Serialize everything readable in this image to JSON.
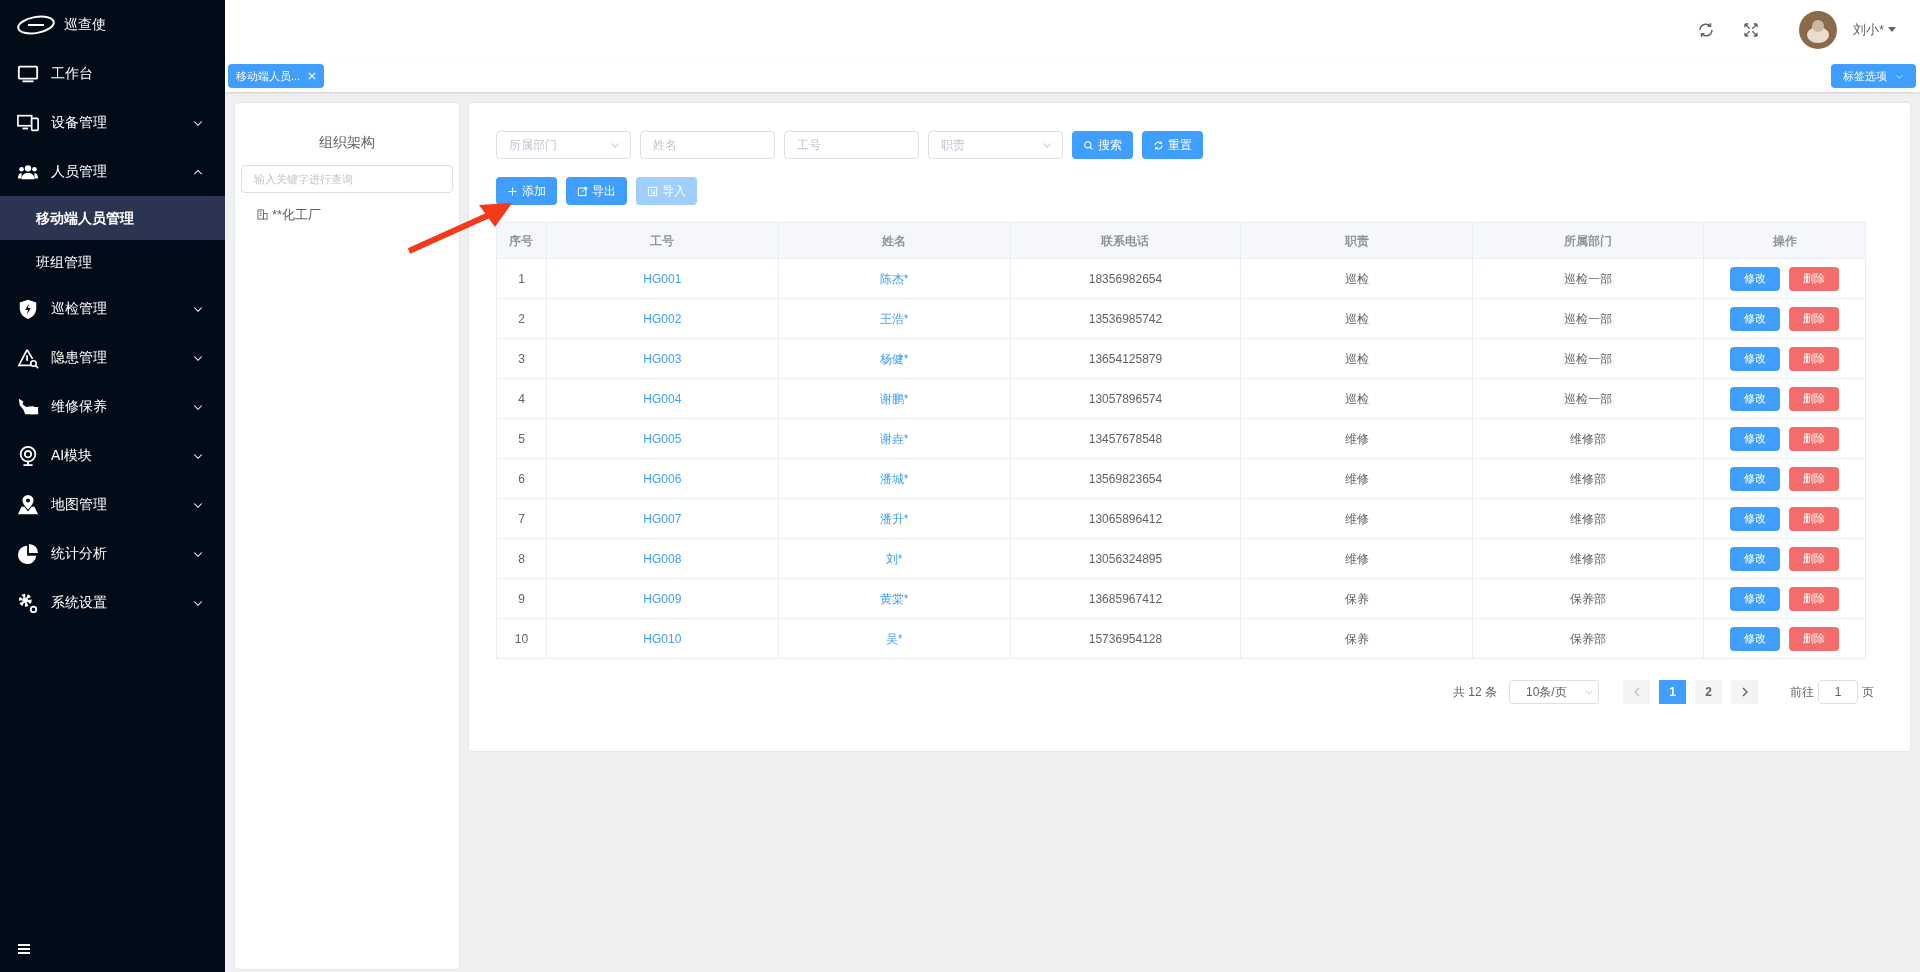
{
  "app": {
    "title": "巡查使"
  },
  "sidebar": {
    "items": [
      {
        "label": "工作台",
        "has_children": false
      },
      {
        "label": "设备管理",
        "expanded": false,
        "has_children": true
      },
      {
        "label": "人员管理",
        "expanded": true,
        "has_children": true,
        "children": [
          {
            "label": "移动端人员管理",
            "selected": true
          },
          {
            "label": "班组管理",
            "selected": false
          }
        ]
      },
      {
        "label": "巡检管理",
        "expanded": false,
        "has_children": true
      },
      {
        "label": "隐患管理",
        "expanded": false,
        "has_children": true
      },
      {
        "label": "维修保养",
        "expanded": false,
        "has_children": true
      },
      {
        "label": "AI模块",
        "expanded": false,
        "has_children": true
      },
      {
        "label": "地图管理",
        "expanded": false,
        "has_children": true
      },
      {
        "label": "统计分析",
        "expanded": false,
        "has_children": true
      },
      {
        "label": "系统设置",
        "expanded": false,
        "has_children": true
      }
    ]
  },
  "header": {
    "user": "刘小*"
  },
  "tabs": [
    {
      "label": "移动端人员...",
      "selected": true
    }
  ],
  "tab_options": "标签选项",
  "org_panel": {
    "title": "组织架构",
    "search_placeholder": "输入关键字进行查询",
    "tree": [
      {
        "label": "**化工厂"
      }
    ]
  },
  "filters": [
    {
      "kind": "select",
      "placeholder": "所属部门"
    },
    {
      "kind": "input",
      "placeholder": "姓名"
    },
    {
      "kind": "input",
      "placeholder": "工号"
    },
    {
      "kind": "select",
      "placeholder": "职责"
    }
  ],
  "filter_buttons": [
    {
      "kind": "search",
      "label": "搜索"
    },
    {
      "kind": "reset",
      "label": "重置"
    }
  ],
  "actions": [
    {
      "kind": "add",
      "label": "添加",
      "disabled": false
    },
    {
      "kind": "export",
      "label": "导出",
      "disabled": false
    },
    {
      "kind": "import",
      "label": "导入",
      "disabled": true
    }
  ],
  "table": {
    "columns": [
      "序号",
      "工号",
      "姓名",
      "联系电话",
      "职责",
      "所属部门",
      "操作"
    ],
    "rows": [
      {
        "cells": [
          "1",
          "HG001",
          "陈杰*",
          "18356982654",
          "巡检",
          "巡检一部"
        ],
        "actions": [
          "修改",
          "删除"
        ]
      },
      {
        "cells": [
          "2",
          "HG002",
          "王浩*",
          "13536985742",
          "巡检",
          "巡检一部"
        ],
        "actions": [
          "修改",
          "删除"
        ]
      },
      {
        "cells": [
          "3",
          "HG003",
          "杨健*",
          "13654125879",
          "巡检",
          "巡检一部"
        ],
        "actions": [
          "修改",
          "删除"
        ]
      },
      {
        "cells": [
          "4",
          "HG004",
          "谢鹏*",
          "13057896574",
          "巡检",
          "巡检一部"
        ],
        "actions": [
          "修改",
          "删除"
        ]
      },
      {
        "cells": [
          "5",
          "HG005",
          "谢垚*",
          "13457678548",
          "维修",
          "维修部"
        ],
        "actions": [
          "修改",
          "删除"
        ]
      },
      {
        "cells": [
          "6",
          "HG006",
          "潘城*",
          "13569823654",
          "维修",
          "维修部"
        ],
        "actions": [
          "修改",
          "删除"
        ]
      },
      {
        "cells": [
          "7",
          "HG007",
          "潘升*",
          "13065896412",
          "维修",
          "维修部"
        ],
        "actions": [
          "修改",
          "删除"
        ]
      },
      {
        "cells": [
          "8",
          "HG008",
          "刘*",
          "13056324895",
          "维修",
          "维修部"
        ],
        "actions": [
          "修改",
          "删除"
        ]
      },
      {
        "cells": [
          "9",
          "HG009",
          "黄棠*",
          "13685967412",
          "保养",
          "保养部"
        ],
        "actions": [
          "修改",
          "删除"
        ]
      },
      {
        "cells": [
          "10",
          "HG010",
          "吴*",
          "15736954128",
          "保养",
          "保养部"
        ],
        "actions": [
          "修改",
          "删除"
        ]
      }
    ]
  },
  "pagination": {
    "total": "共 12 条",
    "page_size": "10条/页",
    "pages": [
      {
        "label": "1",
        "selected": true
      },
      {
        "label": "2",
        "selected": false
      }
    ],
    "goto_label": "前往",
    "goto_value": "1",
    "page_unit": "页"
  }
}
